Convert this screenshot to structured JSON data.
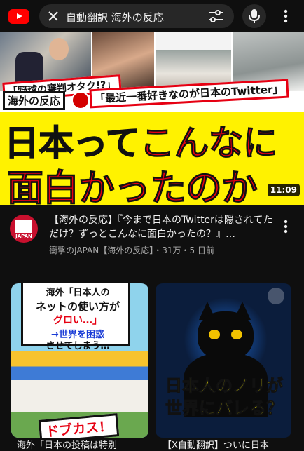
{
  "header": {
    "search_query": "自動翻訳 海外の反応",
    "icons": [
      "youtube-logo-icon",
      "close-icon",
      "filter-icon",
      "mic-icon",
      "more-vertical-icon"
    ]
  },
  "video1": {
    "thumbnail": {
      "caption_1": "「野球の審判オタク!?」",
      "caption_2": "「最近一番好きなのが日本のTwitter」",
      "badge": "海外の反応",
      "headline_line1_black": "日本って",
      "headline_line1_red": "こんなに",
      "headline_line2": "面白かったのか",
      "duration": "11:09"
    },
    "title": "【海外の反応】『今まで日本のTwitterは隠されてただけ？ずっとこんなに面白かったの？』…",
    "channel_avatar_label": "JAPAN",
    "meta": "衝撃のJAPAN【海外の反応】・31万・5 日前"
  },
  "video2": {
    "thumbnail_lines": [
      "海外「日本人の",
      "ネットの使い方が",
      "グロい…」",
      "→世界を困惑",
      "させてしまう…"
    ],
    "pill": "ドブカス！",
    "title": "海外「日本の投稿は特別"
  },
  "video3": {
    "thumbnail_line1": "日本人のノリが",
    "thumbnail_line2": "世界にバレる？",
    "title": "【X自動翻訳】ついに日本"
  },
  "colors": {
    "background": "#0f0f0f",
    "youtube_red": "#ff0000",
    "banner_yellow": "#fff200",
    "headline_red": "#e60012",
    "secondary_text": "#aaaaaa"
  }
}
